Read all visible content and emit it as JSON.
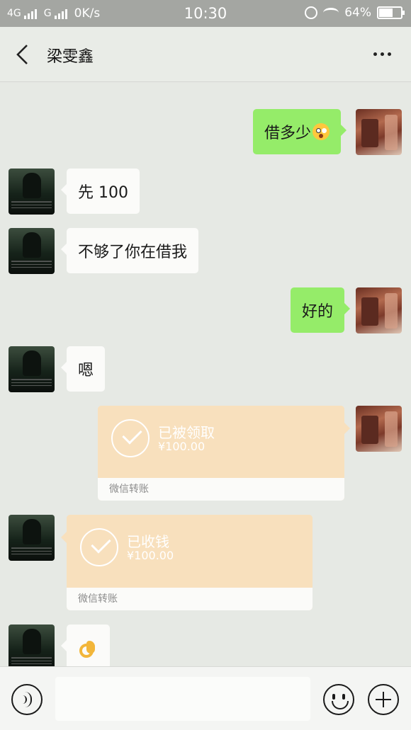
{
  "status_bar": {
    "network1": "4G",
    "network2": "G",
    "speed": "0K/s",
    "time": "10:30",
    "battery_text": "64%",
    "battery_level": 0.64
  },
  "header": {
    "title": "梁雯鑫"
  },
  "messages": [
    {
      "from": "me",
      "text": "借多少",
      "emoji": "surprised-face"
    },
    {
      "from": "other",
      "text": "先 100"
    },
    {
      "from": "other",
      "text": "不够了你在借我"
    },
    {
      "from": "me",
      "text": "好的"
    },
    {
      "from": "other",
      "text": "嗯"
    },
    {
      "from": "me",
      "type": "transfer",
      "title": "已被领取",
      "amount": "¥100.00",
      "footer": "微信转账"
    },
    {
      "from": "other",
      "type": "transfer",
      "title": "已收钱",
      "amount": "¥100.00",
      "footer": "微信转账"
    },
    {
      "from": "other",
      "emoji": "ok-hand"
    }
  ],
  "input": {
    "value": "",
    "placeholder": ""
  },
  "colors": {
    "my_bubble": "#95ec69",
    "other_bubble": "#fbfbf9",
    "transfer_card": "#f8e0bd",
    "chat_background": "#e6e9e4"
  }
}
